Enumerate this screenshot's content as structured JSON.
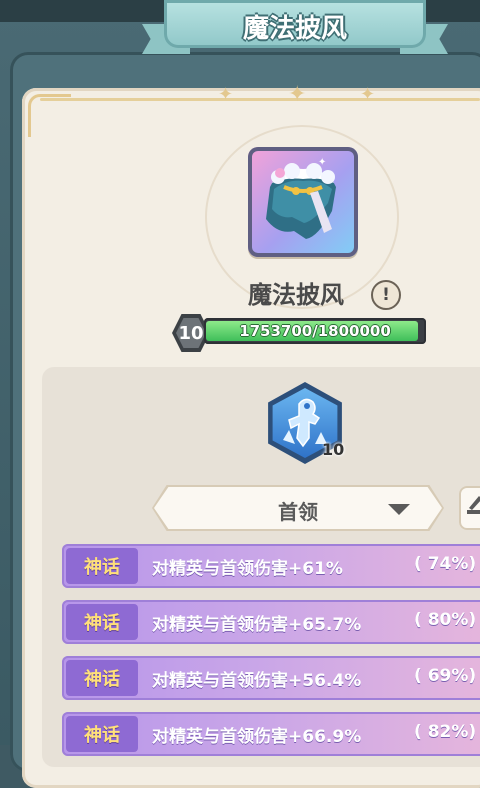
{
  "header": {
    "title": "魔法披风"
  },
  "item": {
    "name": "魔法披风",
    "level": "10",
    "xp_text": "1753700/1800000",
    "xp_fraction": 0.974
  },
  "skill": {
    "level": "10"
  },
  "filter": {
    "selected": "首领"
  },
  "stats": [
    {
      "tag": "神话",
      "text": "对精英与首领伤害+61%",
      "pct": "( 74%)"
    },
    {
      "tag": "神话",
      "text": "对精英与首领伤害+65.7%",
      "pct": "( 80%)"
    },
    {
      "tag": "神话",
      "text": "对精英与首领伤害+56.4%",
      "pct": "( 69%)"
    },
    {
      "tag": "神话",
      "text": "对精英与首领伤害+66.9%",
      "pct": "( 82%)"
    }
  ],
  "colors": {
    "frame": "#4f717b",
    "panel": "#f3eee4",
    "xp_fill": "#3fbf5a",
    "stat_row": "#c9a6e8",
    "tag": "#8e6ad3",
    "tag_text": "#ffe07a"
  },
  "icons": {
    "item": "cape-icon",
    "info": "exclamation-icon",
    "skill": "ice-figure-icon",
    "dropdown": "caret-down-icon",
    "side": "edit-icon"
  }
}
